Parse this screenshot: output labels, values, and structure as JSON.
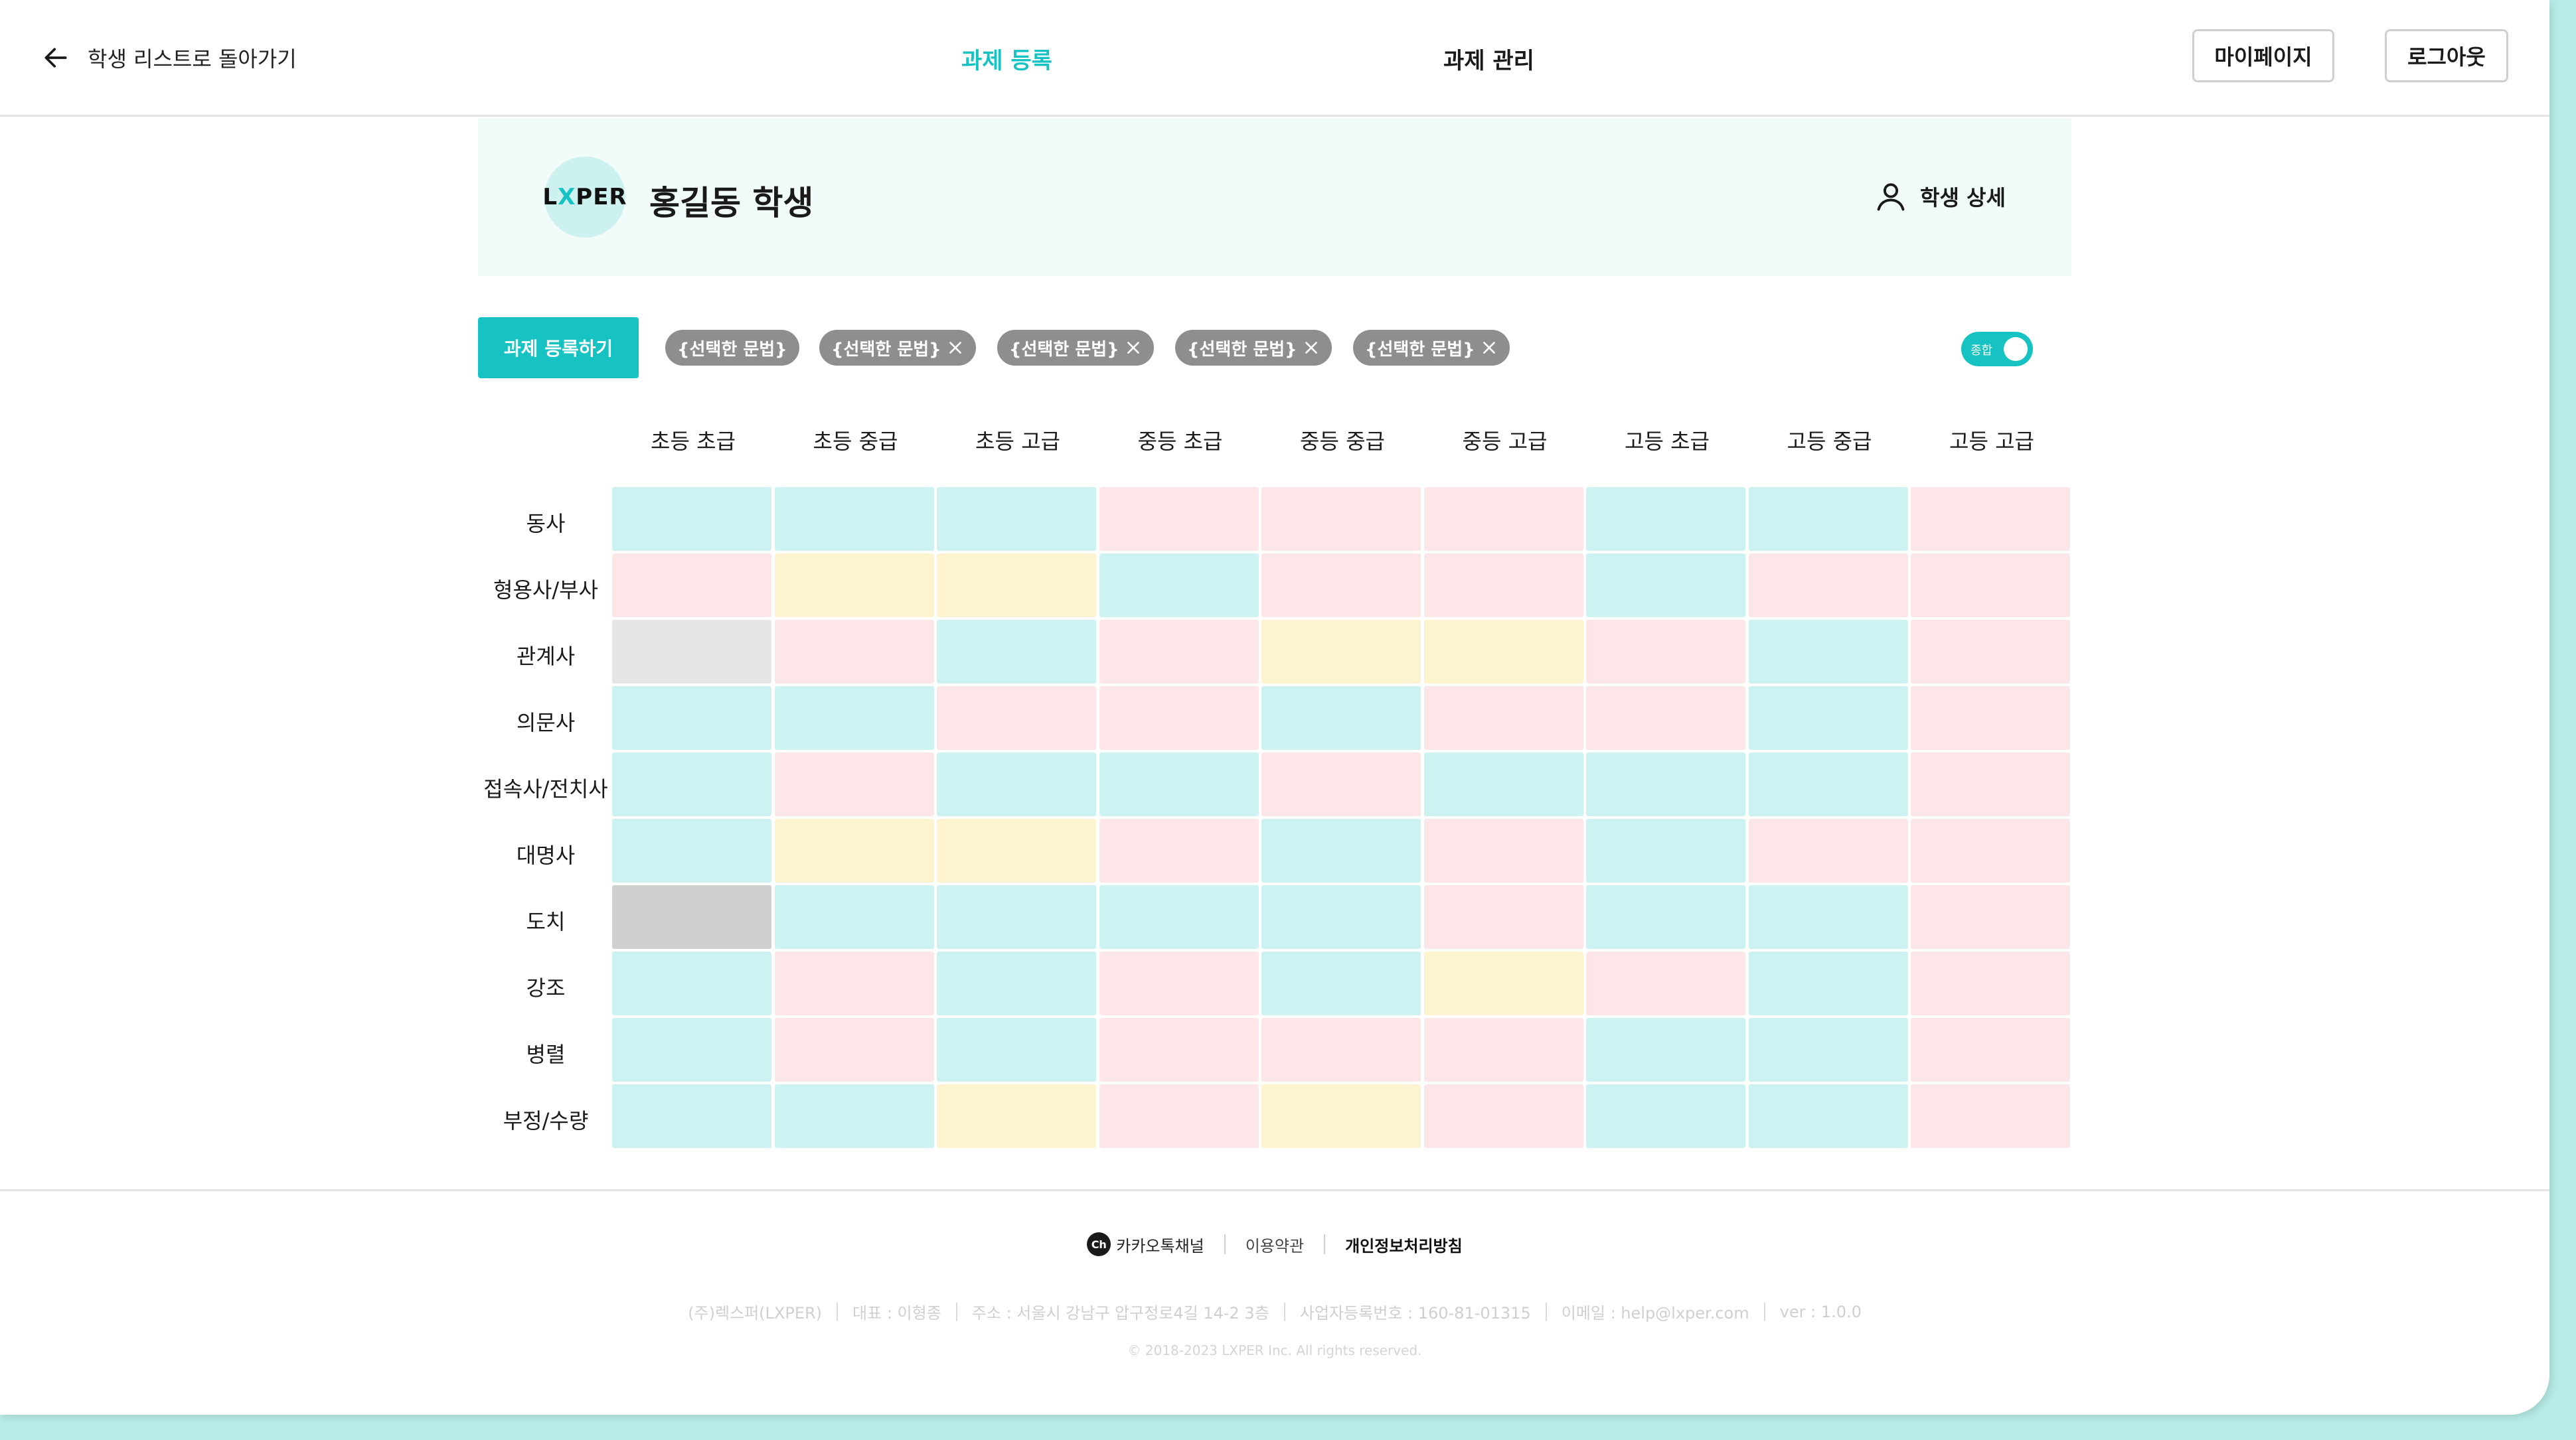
{
  "header": {
    "back_label": "학생 리스트로 돌아가기",
    "nav": [
      "과제 등록",
      "과제 관리"
    ],
    "mypage_label": "마이페이지",
    "logout_label": "로그아웃",
    "accent_color": "#16c2c2"
  },
  "student": {
    "logo_text": "LXPER",
    "name": "홍길동 학생",
    "detail_label": "학생 상세"
  },
  "toolbar": {
    "register_label": "과제 등록하기",
    "chips": [
      "{선택한 문법}",
      "{선택한 문법}",
      "{선택한 문법}",
      "{선택한 문법}",
      "{선택한 문법}"
    ],
    "toggle_label": "종합",
    "toggle_on": true
  },
  "grid": {
    "columns": [
      "초등 초급",
      "초등 중급",
      "초등 고급",
      "중등 초급",
      "중등 중급",
      "중등 고급",
      "고등 초급",
      "고등 중급",
      "고등 고급"
    ],
    "rows": [
      {
        "label": "동사",
        "cells": [
          "teal",
          "teal",
          "teal",
          "pink",
          "pink",
          "pink",
          "teal",
          "teal",
          "pink"
        ]
      },
      {
        "label": "형용사/부사",
        "cells": [
          "pink",
          "yellow",
          "yellow",
          "teal",
          "pink",
          "pink",
          "teal",
          "pink",
          "pink"
        ]
      },
      {
        "label": "관계사",
        "cells": [
          "gray",
          "pink",
          "teal",
          "pink",
          "yellow",
          "yellow",
          "pink",
          "teal",
          "pink"
        ]
      },
      {
        "label": "의문사",
        "cells": [
          "teal",
          "teal",
          "pink",
          "pink",
          "teal",
          "pink",
          "pink",
          "teal",
          "pink"
        ]
      },
      {
        "label": "접속사/전치사",
        "cells": [
          "teal",
          "pink",
          "teal",
          "teal",
          "pink",
          "teal",
          "teal",
          "teal",
          "pink"
        ]
      },
      {
        "label": "대명사",
        "cells": [
          "teal",
          "yellow",
          "yellow",
          "pink",
          "teal",
          "pink",
          "teal",
          "pink",
          "pink"
        ]
      },
      {
        "label": "도치",
        "cells": [
          "dgray",
          "teal",
          "teal",
          "teal",
          "teal",
          "pink",
          "teal",
          "teal",
          "pink"
        ]
      },
      {
        "label": "강조",
        "cells": [
          "teal",
          "pink",
          "teal",
          "pink",
          "teal",
          "yellow",
          "pink",
          "teal",
          "pink"
        ]
      },
      {
        "label": "병렬",
        "cells": [
          "teal",
          "pink",
          "teal",
          "pink",
          "pink",
          "pink",
          "teal",
          "teal",
          "pink"
        ]
      },
      {
        "label": "부정/수량",
        "cells": [
          "teal",
          "teal",
          "yellow",
          "pink",
          "yellow",
          "pink",
          "teal",
          "teal",
          "pink"
        ]
      }
    ],
    "colors": {
      "teal": "#ccf3f1",
      "pink": "#fde6e8",
      "yellow": "#fdf3cf",
      "gray": "#e6e6e6",
      "dgray": "#cfcfcf"
    }
  },
  "footer": {
    "kakao_label": "카카오톡채널",
    "terms_label": "이용약관",
    "privacy_label": "개인정보처리방침",
    "info": [
      "(주)렉스퍼(LXPER)",
      "대표 : 이형종",
      "주소 : 서울시 강남구 압구정로4길 14-2 3층",
      "사업자등록번호 : 160-81-01315",
      "이메일 : help@lxper.com",
      "ver : 1.0.0"
    ],
    "copyright": "© 2018-2023 LXPER Inc. All rights reserved."
  }
}
